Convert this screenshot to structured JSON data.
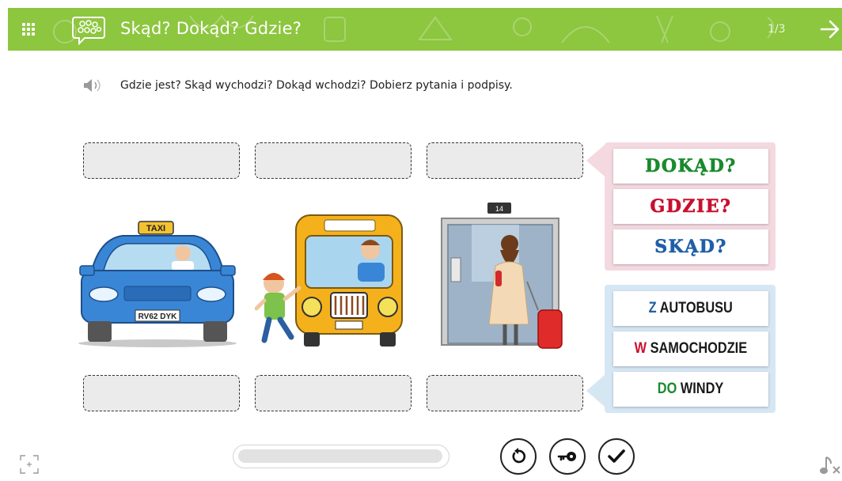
{
  "header": {
    "title": "Skąd? Dokąd? Gdzie?",
    "page_counter": "1/3",
    "bg_color": "#8dc63f"
  },
  "instruction": {
    "text": "Gdzie jest? Skąd wychodzi? Dokąd wchodzi?  Dobierz pytania i podpisy."
  },
  "slots": {
    "top": [
      "",
      "",
      ""
    ],
    "bottom": [
      "",
      "",
      ""
    ]
  },
  "images": {
    "taxi_sign": "TAXI",
    "license_plate": "RV62 DYK",
    "elevator_floor": "14"
  },
  "questions": [
    {
      "label": "DOKĄD?",
      "color": "#1a8a2e"
    },
    {
      "label": "GDZIE?",
      "color": "#c8102e"
    },
    {
      "label": "SKĄD?",
      "color": "#1f5fa8"
    }
  ],
  "answers": [
    {
      "prefix": "Z",
      "rest": " AUTOBUSU",
      "prefix_color": "#1f5fa8"
    },
    {
      "prefix": "W",
      "rest": " SAMOCHODZIE",
      "prefix_color": "#c8102e"
    },
    {
      "prefix": "DO",
      "rest": " WINDY",
      "prefix_color": "#1a8a2e"
    }
  ],
  "progress": {
    "value": 0
  },
  "icons": {
    "menu": "grid-menu-icon",
    "logo": "speech-bubble-icon",
    "next": "arrow-right-icon",
    "audio": "speaker-icon",
    "fullscreen": "fullscreen-icon",
    "reset": "reset-icon",
    "key": "key-icon",
    "check": "check-icon",
    "music": "music-mute-icon"
  }
}
